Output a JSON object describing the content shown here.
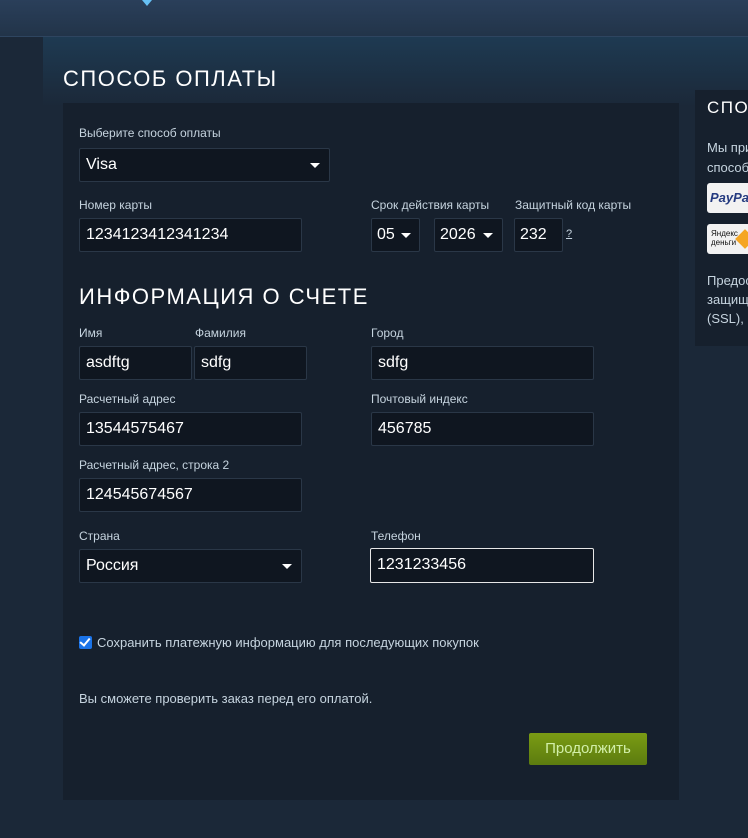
{
  "page_title": "СПОСОБ ОПЛАТЫ",
  "payment": {
    "method_label": "Выберите способ оплаты",
    "method_value": "Visa",
    "card_number_label": "Номер карты",
    "card_number_value": "1234123412341234",
    "expiry_label": "Срок действия карты",
    "expiry_month": "05",
    "expiry_year": "2026",
    "cvv_label": "Защитный код карты",
    "cvv_value": "232",
    "cvv_help": "?"
  },
  "billing": {
    "section_title": "ИНФОРМАЦИЯ О СЧЕТЕ",
    "first_name_label": "Имя",
    "first_name_value": "asdftg",
    "last_name_label": "Фамилия",
    "last_name_value": "sdfg",
    "city_label": "Город",
    "city_value": "sdfg",
    "address_label": "Расчетный адрес",
    "address_value": "13544575467",
    "zip_label": "Почтовый индекс",
    "zip_value": "456785",
    "address2_label": "Расчетный адрес, строка 2",
    "address2_value": "124545674567",
    "country_label": "Страна",
    "country_value": "Россия",
    "phone_label": "Телефон",
    "phone_value": "1231233456"
  },
  "save_info": {
    "checked": true,
    "label": "Сохранить платежную информацию для последующих покупок"
  },
  "review_note": "Вы сможете проверить заказ перед его оплатой.",
  "continue_label": "Продолжить",
  "side": {
    "title": "СПО",
    "text_line1": "Мы при",
    "text_line2": "способ",
    "paypal_logo": "PayPal",
    "yandex_logo_line1": "Яндекс",
    "yandex_logo_line2": "деньги",
    "footer_line1": "Предос",
    "footer_line2": "защищ",
    "footer_line3": "(SSL), и"
  },
  "colors": {
    "background": "#1b2838",
    "panel": "#16202d",
    "input_bg": "#0f1620",
    "button_green": "#6b8a12",
    "checkbox_blue": "#1a73e8"
  }
}
